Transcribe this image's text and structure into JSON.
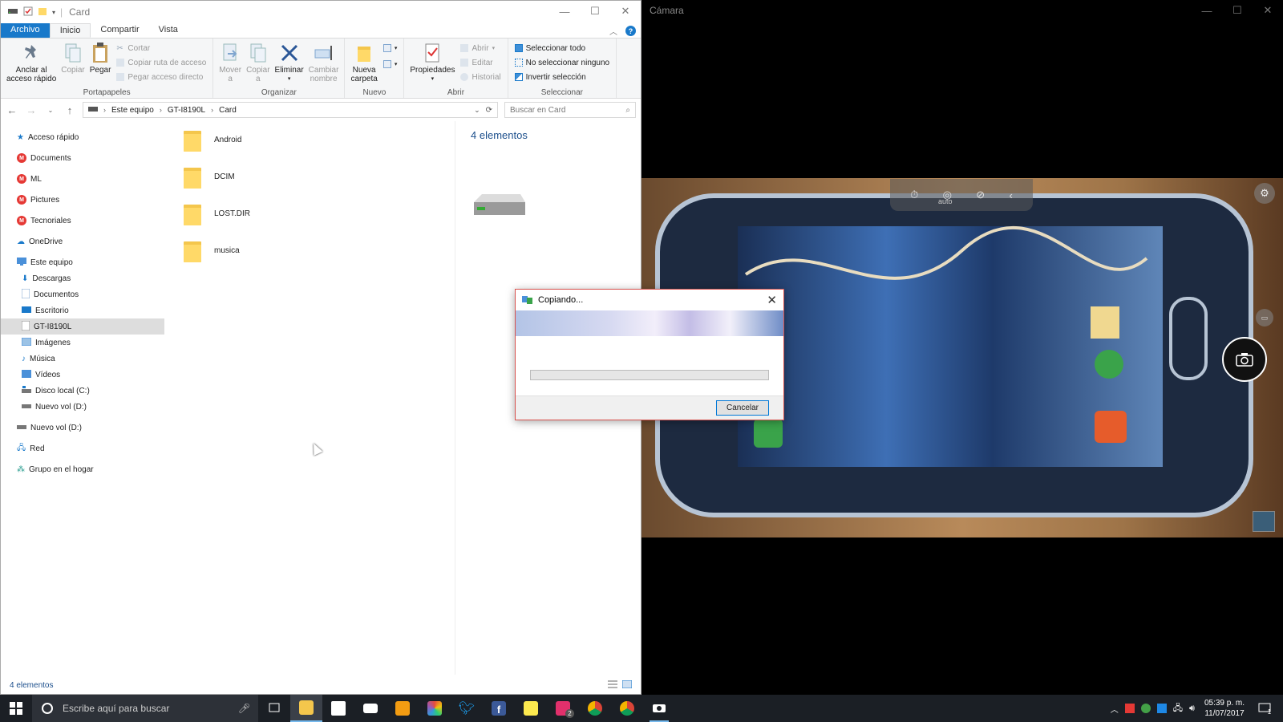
{
  "explorer": {
    "window_title": "Card",
    "tabs": [
      {
        "label": "Archivo"
      },
      {
        "label": "Inicio"
      },
      {
        "label": "Compartir"
      },
      {
        "label": "Vista"
      }
    ],
    "ribbon": {
      "portapapeles": {
        "group_label": "Portapapeles",
        "pin_label_1": "Anclar al",
        "pin_label_2": "acceso rápido",
        "copy_label": "Copiar",
        "paste_label": "Pegar",
        "cut_label": "Cortar",
        "copy_path_label": "Copiar ruta de acceso",
        "paste_shortcut_label": "Pegar acceso directo"
      },
      "organizar": {
        "group_label": "Organizar",
        "move_label_1": "Mover",
        "move_label_2": "a",
        "copyto_label_1": "Copiar",
        "copyto_label_2": "a",
        "delete_label": "Eliminar",
        "rename_label_1": "Cambiar",
        "rename_label_2": "nombre"
      },
      "nuevo": {
        "group_label": "Nuevo",
        "new_folder_label_1": "Nueva",
        "new_folder_label_2": "carpeta"
      },
      "abrir": {
        "group_label": "Abrir",
        "properties_label": "Propiedades",
        "open_label": "Abrir",
        "edit_label": "Editar",
        "history_label": "Historial"
      },
      "seleccionar": {
        "group_label": "Seleccionar",
        "select_all_label": "Seleccionar todo",
        "select_none_label": "No seleccionar ninguno",
        "invert_label": "Invertir selección"
      }
    },
    "breadcrumb": [
      "Este equipo",
      "GT-I8190L",
      "Card"
    ],
    "search_placeholder": "Buscar en Card",
    "nav": {
      "quick_access": "Acceso rápido",
      "documents_ml": "Documents",
      "ml": "ML",
      "pictures": "Pictures",
      "tecnoriales": "Tecnoriales",
      "onedrive": "OneDrive",
      "this_pc": "Este equipo",
      "downloads": "Descargas",
      "documentos": "Documentos",
      "desktop": "Escritorio",
      "device": "GT-I8190L",
      "images": "Imágenes",
      "music": "Música",
      "videos": "Vídeos",
      "local_disk": "Disco local (C:)",
      "new_vol_sub": "Nuevo vol (D:)",
      "new_vol": "Nuevo vol (D:)",
      "network": "Red",
      "homegroup": "Grupo en el hogar"
    },
    "files": [
      {
        "name": "Android"
      },
      {
        "name": "DCIM"
      },
      {
        "name": "LOST.DIR"
      },
      {
        "name": "musica"
      }
    ],
    "preview_title": "4 elementos",
    "status_text": "4 elementos"
  },
  "camera": {
    "window_title": "Cámara",
    "mode_label": "auto"
  },
  "copy_dialog": {
    "title": "Copiando...",
    "cancel_label": "Cancelar",
    "progress_percent": 0,
    "progress_color": "#06b025"
  },
  "taskbar": {
    "search_placeholder": "Escribe aquí para buscar",
    "apps": [
      {
        "icon": "task-view-icon"
      },
      {
        "icon": "file-explorer-icon"
      },
      {
        "icon": "store-icon"
      },
      {
        "icon": "mail-icon"
      },
      {
        "icon": "media-player-icon"
      },
      {
        "icon": "photos-icon"
      },
      {
        "icon": "twitter-icon"
      },
      {
        "icon": "facebook-icon"
      },
      {
        "icon": "sticky-notes-icon"
      },
      {
        "icon": "instagram-icon"
      },
      {
        "icon": "chrome-icon"
      },
      {
        "icon": "chrome-icon"
      },
      {
        "icon": "camera-icon"
      }
    ],
    "instagram_badge": "2",
    "clock_time": "05:39 p. m.",
    "clock_date": "11/07/2017",
    "notification_count": "1"
  },
  "colors": {
    "accent": "#1979ca",
    "folder": "#ffd968",
    "taskbar": "#1b1f25"
  }
}
